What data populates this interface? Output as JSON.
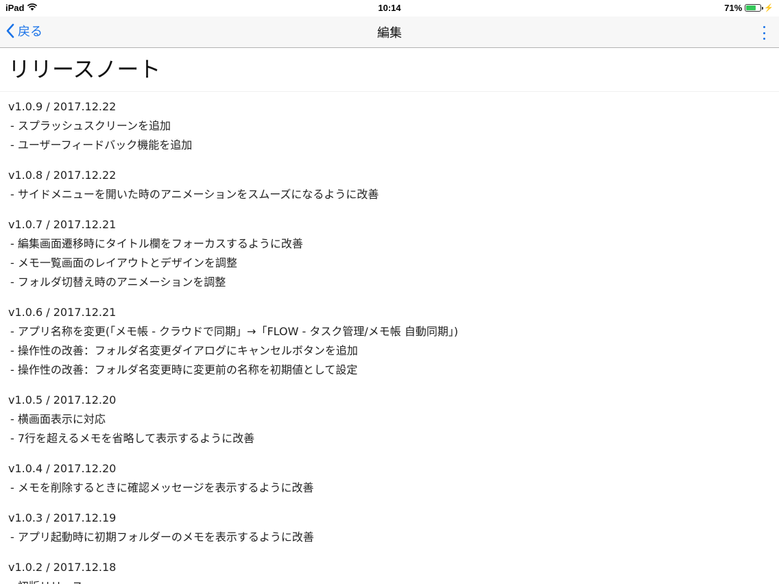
{
  "status_bar": {
    "device": "iPad",
    "time": "10:14",
    "battery_percent": "71%",
    "battery_level": 0.71,
    "battery_color": "#34c759",
    "icons": [
      "wifi-icon",
      "battery-icon",
      "charging-bolt-icon"
    ]
  },
  "nav": {
    "back_label": "戻る",
    "title": "編集",
    "accent_color": "#1a73e8",
    "icons": [
      "chevron-left-icon",
      "more-vertical-icon"
    ]
  },
  "page": {
    "title": "リリースノート"
  },
  "releases": [
    {
      "version": "v1.0.9 / 2017.12.22",
      "items": [
        "- スプラッシュスクリーンを追加",
        "- ユーザーフィードバック機能を追加"
      ]
    },
    {
      "version": "v1.0.8 / 2017.12.22",
      "items": [
        "- サイドメニューを開いた時のアニメーションをスムーズになるように改善"
      ]
    },
    {
      "version": "v1.0.7 / 2017.12.21",
      "items": [
        "- 編集画面遷移時にタイトル欄をフォーカスするように改善",
        "- メモ一覧画面のレイアウトとデザインを調整",
        "- フォルダ切替え時のアニメーションを調整"
      ]
    },
    {
      "version": "v1.0.6 / 2017.12.21",
      "items": [
        "- アプリ名称を変更(「メモ帳 - クラウドで同期」→「FLOW - タスク管理/メモ帳 自動同期」)",
        "- 操作性の改善：フォルダ名変更ダイアログにキャンセルボタンを追加",
        "- 操作性の改善：フォルダ名変更時に変更前の名称を初期値として設定"
      ]
    },
    {
      "version": "v1.0.5 / 2017.12.20",
      "items": [
        "- 横画面表示に対応",
        "- 7行を超えるメモを省略して表示するように改善"
      ]
    },
    {
      "version": "v1.0.4 / 2017.12.20",
      "items": [
        "- メモを削除するときに確認メッセージを表示するように改善"
      ]
    },
    {
      "version": "v1.0.3 / 2017.12.19",
      "items": [
        "- アプリ起動時に初期フォルダーのメモを表示するように改善"
      ]
    },
    {
      "version": "v1.0.2 / 2017.12.18",
      "items": [
        "- 初版リリース"
      ]
    }
  ]
}
